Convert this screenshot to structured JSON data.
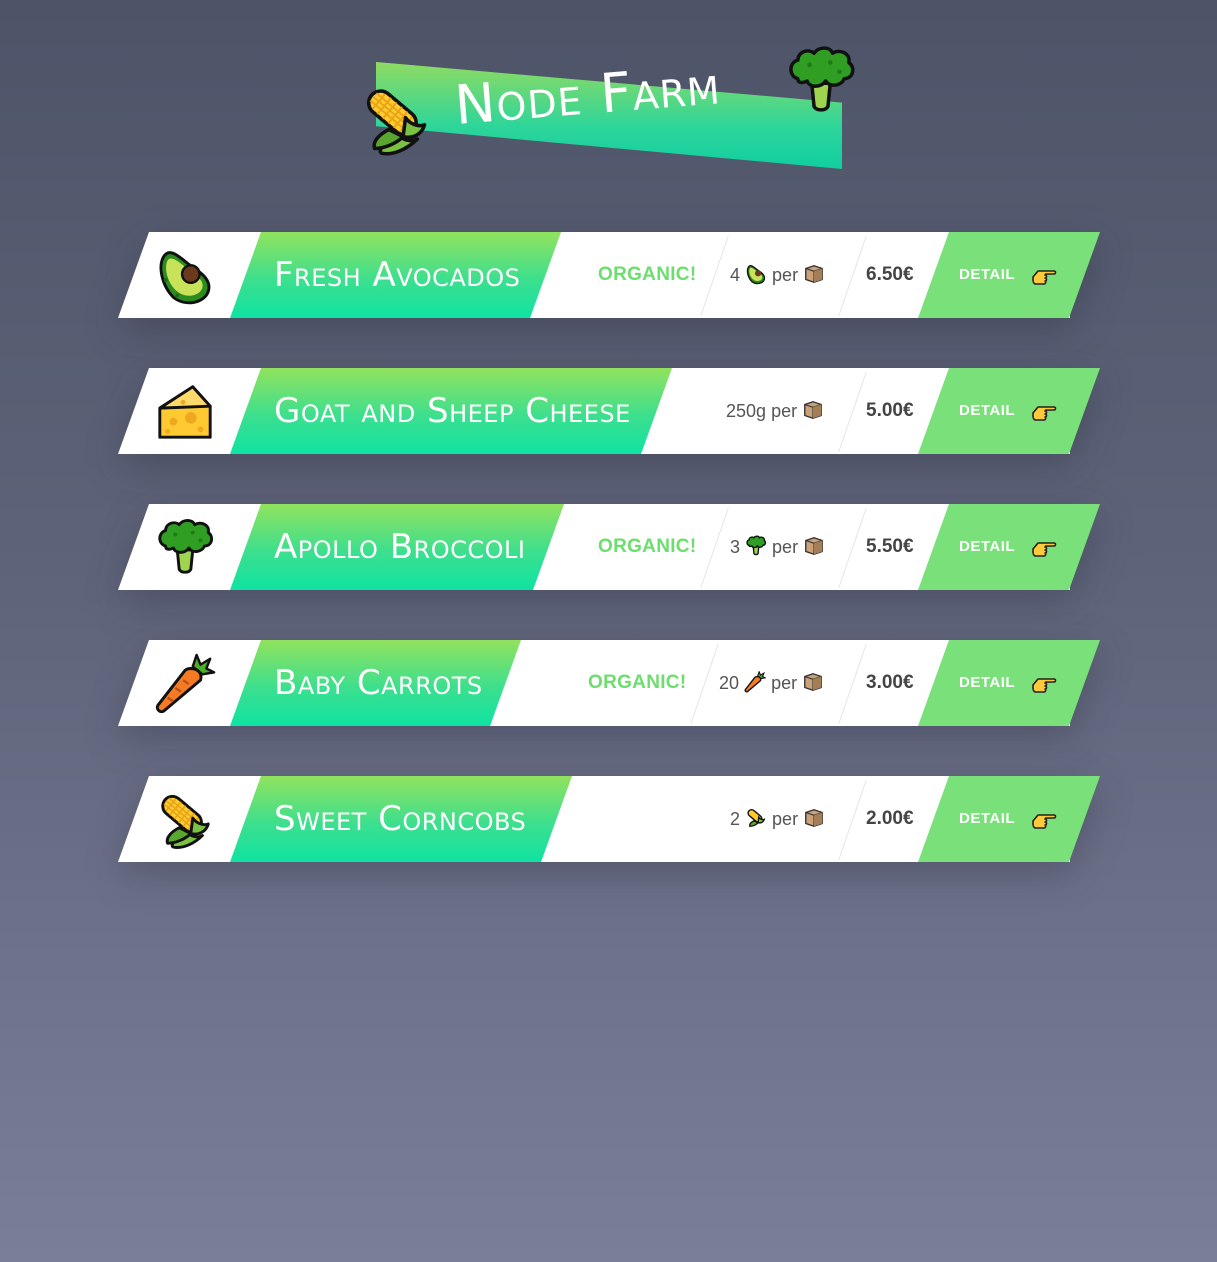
{
  "header": {
    "title": "Node Farm",
    "left_icon": "corn-icon",
    "right_icon": "broccoli-icon"
  },
  "colors": {
    "accent_green": "#7ae17a",
    "gradient_top": "#91e25e",
    "gradient_bottom": "#0ee3a2",
    "organic": "#6dde6d"
  },
  "products": [
    {
      "icon": "avocado-icon",
      "name": "Fresh Avocados",
      "organic": "ORGANIC!",
      "quantity": "4",
      "quantity_icon": "avocado-icon",
      "per": "per",
      "box_icon": "box-icon",
      "price": "6.50€",
      "detail": "DETAIL",
      "detail_icon": "pointing-hand-icon"
    },
    {
      "icon": "cheese-icon",
      "name": "Goat and Sheep Cheese",
      "organic": "",
      "quantity": "250g",
      "quantity_icon": "",
      "per": "per",
      "box_icon": "box-icon",
      "price": "5.00€",
      "detail": "DETAIL",
      "detail_icon": "pointing-hand-icon"
    },
    {
      "icon": "broccoli-icon",
      "name": "Apollo Broccoli",
      "organic": "ORGANIC!",
      "quantity": "3",
      "quantity_icon": "broccoli-icon",
      "per": "per",
      "box_icon": "box-icon",
      "price": "5.50€",
      "detail": "DETAIL",
      "detail_icon": "pointing-hand-icon"
    },
    {
      "icon": "carrot-icon",
      "name": "Baby Carrots",
      "organic": "ORGANIC!",
      "quantity": "20",
      "quantity_icon": "carrot-icon",
      "per": "per",
      "box_icon": "box-icon",
      "price": "3.00€",
      "detail": "DETAIL",
      "detail_icon": "pointing-hand-icon"
    },
    {
      "icon": "corn-icon",
      "name": "Sweet Corncobs",
      "organic": "",
      "quantity": "2",
      "quantity_icon": "corn-icon",
      "per": "per",
      "box_icon": "box-icon",
      "price": "2.00€",
      "detail": "DETAIL",
      "detail_icon": "pointing-hand-icon"
    }
  ]
}
